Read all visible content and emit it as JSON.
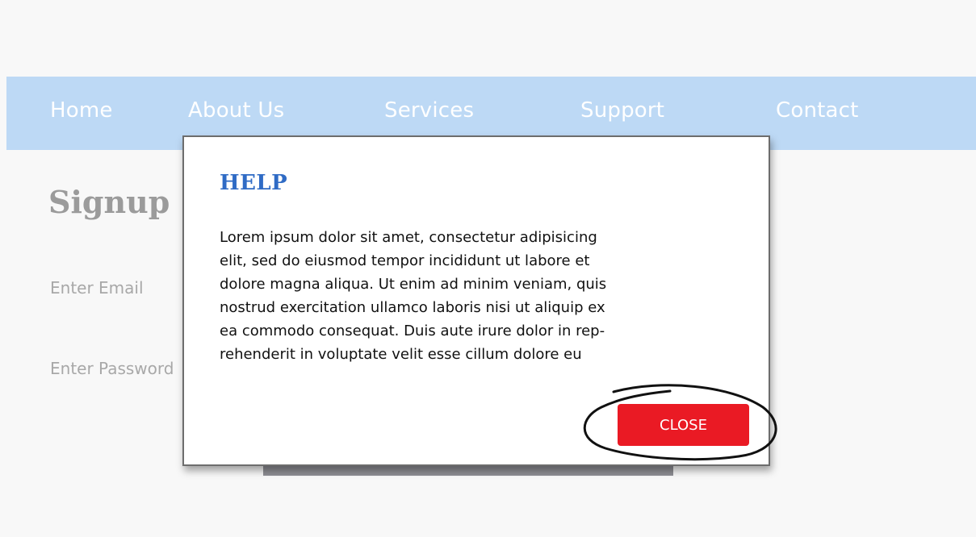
{
  "nav": {
    "items": [
      {
        "label": "Home"
      },
      {
        "label": "About Us"
      },
      {
        "label": "Services"
      },
      {
        "label": "Support"
      },
      {
        "label": "Contact"
      }
    ]
  },
  "signup": {
    "title": "Signup",
    "email_label": "Enter Email",
    "password_label": "Enter Password"
  },
  "dialog": {
    "title": "HELP",
    "body_lines": [
      "Lorem ipsum dolor sit amet, consectetur adipisicing",
      "elit, sed do eiusmod tempor incididunt ut labore et",
      "dolore magna aliqua. Ut enim ad minim veniam, quis",
      "nostrud exercitation ullamco laboris nisi ut aliquip ex",
      "ea commodo consequat. Duis aute irure dolor in rep-",
      "rehenderit in voluptate velit esse cillum dolore eu"
    ],
    "close_label": "CLOSE"
  },
  "colors": {
    "nav_bg": "#bdd9f5",
    "dialog_title": "#2f6bc5",
    "close_button": "#ea1a24"
  }
}
